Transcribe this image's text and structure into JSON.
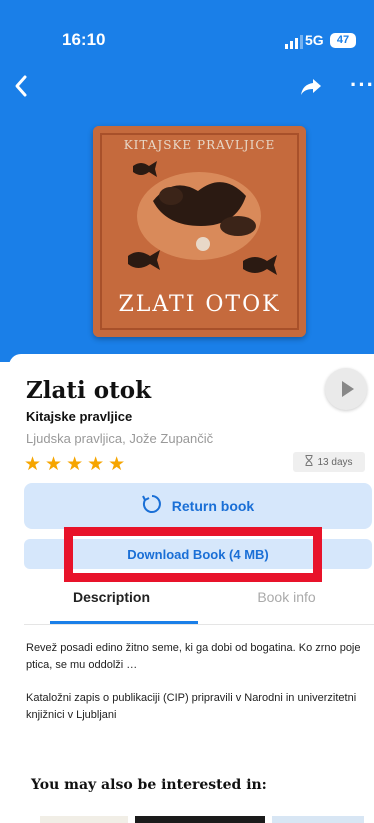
{
  "status_bar": {
    "time": "16:10",
    "network": "5G",
    "battery": "47"
  },
  "icons": {
    "back": "chevron-left-icon",
    "share": "share-arrow-icon",
    "more": "ellipsis-icon",
    "play": "play-icon",
    "hourglass": "hourglass-icon",
    "return": "refresh-icon"
  },
  "colors": {
    "hero": "#1a7fe8",
    "accent": "#1a6fd6",
    "button_bg": "#d6e7fb",
    "highlight": "#e8132a",
    "stars": "#f6a500"
  },
  "cover": {
    "subtitle": "KITAJSKE PRAVLJICE",
    "title": "ZLATI OTOK"
  },
  "book": {
    "title": "Zlati otok",
    "subtitle": "Kitajske pravljice",
    "authors": "Ljudska pravljica, Jože Zupančič",
    "rating": 5,
    "stars": "★★★★★",
    "loan_remaining": "13 days"
  },
  "actions": {
    "return_label": "Return book",
    "download_label": "Download Book (4 MB)"
  },
  "tabs": [
    {
      "label": "Description",
      "active": true
    },
    {
      "label": "Book info",
      "active": false
    }
  ],
  "description": {
    "paragraph1": "Revež posadi edino žitno seme, ki ga dobi od bogatina. Ko zrno  poje ptica, se mu  oddolži …",
    "paragraph2": "Kataložni zapis o publikaciji (CIP) pripravili v Narodni in univerzitetni knjižnici v Ljubljani"
  },
  "recommendations": {
    "heading": "You may also be interested in:"
  }
}
